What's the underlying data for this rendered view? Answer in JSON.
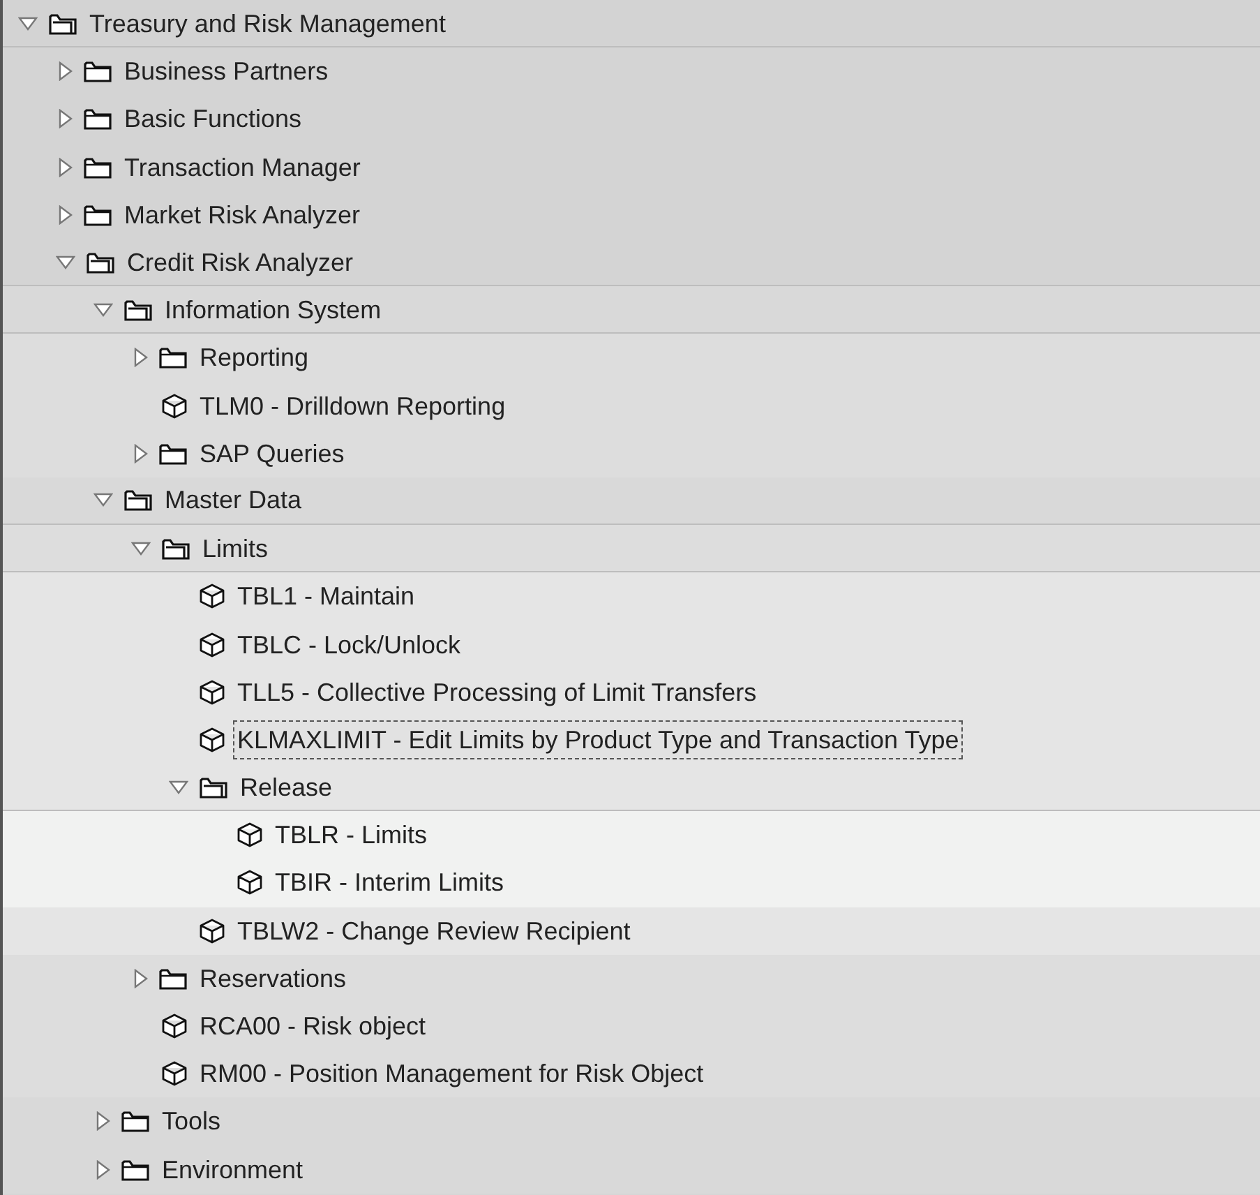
{
  "tree": [
    {
      "label": "Treasury and Risk Management",
      "kind": "folder",
      "expanded": true,
      "selected": false,
      "children": [
        {
          "label": "Business Partners",
          "kind": "folder",
          "expanded": false,
          "selected": false
        },
        {
          "label": "Basic Functions",
          "kind": "folder",
          "expanded": false,
          "selected": false
        },
        {
          "label": "Transaction Manager",
          "kind": "folder",
          "expanded": false,
          "selected": false
        },
        {
          "label": "Market Risk Analyzer",
          "kind": "folder",
          "expanded": false,
          "selected": false
        },
        {
          "label": "Credit Risk Analyzer",
          "kind": "folder",
          "expanded": true,
          "selected": false,
          "children": [
            {
              "label": "Information System",
              "kind": "folder",
              "expanded": true,
              "selected": false,
              "children": [
                {
                  "label": "Reporting",
                  "kind": "folder",
                  "expanded": false,
                  "selected": false
                },
                {
                  "label": "TLM0 - Drilldown Reporting",
                  "kind": "transaction",
                  "selected": false
                },
                {
                  "label": "SAP Queries",
                  "kind": "folder",
                  "expanded": false,
                  "selected": false
                }
              ]
            },
            {
              "label": "Master Data",
              "kind": "folder",
              "expanded": true,
              "selected": false,
              "children": [
                {
                  "label": "Limits",
                  "kind": "folder",
                  "expanded": true,
                  "selected": false,
                  "children": [
                    {
                      "label": "TBL1 - Maintain",
                      "kind": "transaction",
                      "selected": false
                    },
                    {
                      "label": "TBLC - Lock/Unlock",
                      "kind": "transaction",
                      "selected": false
                    },
                    {
                      "label": "TLL5 - Collective Processing of Limit Transfers",
                      "kind": "transaction",
                      "selected": false
                    },
                    {
                      "label": "KLMAXLIMIT - Edit Limits by Product Type and Transaction Type",
                      "kind": "transaction",
                      "selected": true
                    },
                    {
                      "label": "Release",
                      "kind": "folder",
                      "expanded": true,
                      "selected": false,
                      "children": [
                        {
                          "label": "TBLR - Limits",
                          "kind": "transaction",
                          "selected": false
                        },
                        {
                          "label": "TBIR - Interim Limits",
                          "kind": "transaction",
                          "selected": false
                        }
                      ]
                    },
                    {
                      "label": "TBLW2 - Change Review Recipient",
                      "kind": "transaction",
                      "selected": false
                    }
                  ]
                },
                {
                  "label": "Reservations",
                  "kind": "folder",
                  "expanded": false,
                  "selected": false
                },
                {
                  "label": "RCA00 - Risk object",
                  "kind": "transaction",
                  "selected": false
                },
                {
                  "label": "RM00 - Position Management for Risk Object",
                  "kind": "transaction",
                  "selected": false
                }
              ]
            },
            {
              "label": "Tools",
              "kind": "folder",
              "expanded": false,
              "selected": false
            },
            {
              "label": "Environment",
              "kind": "folder",
              "expanded": false,
              "selected": false
            }
          ]
        }
      ]
    }
  ]
}
